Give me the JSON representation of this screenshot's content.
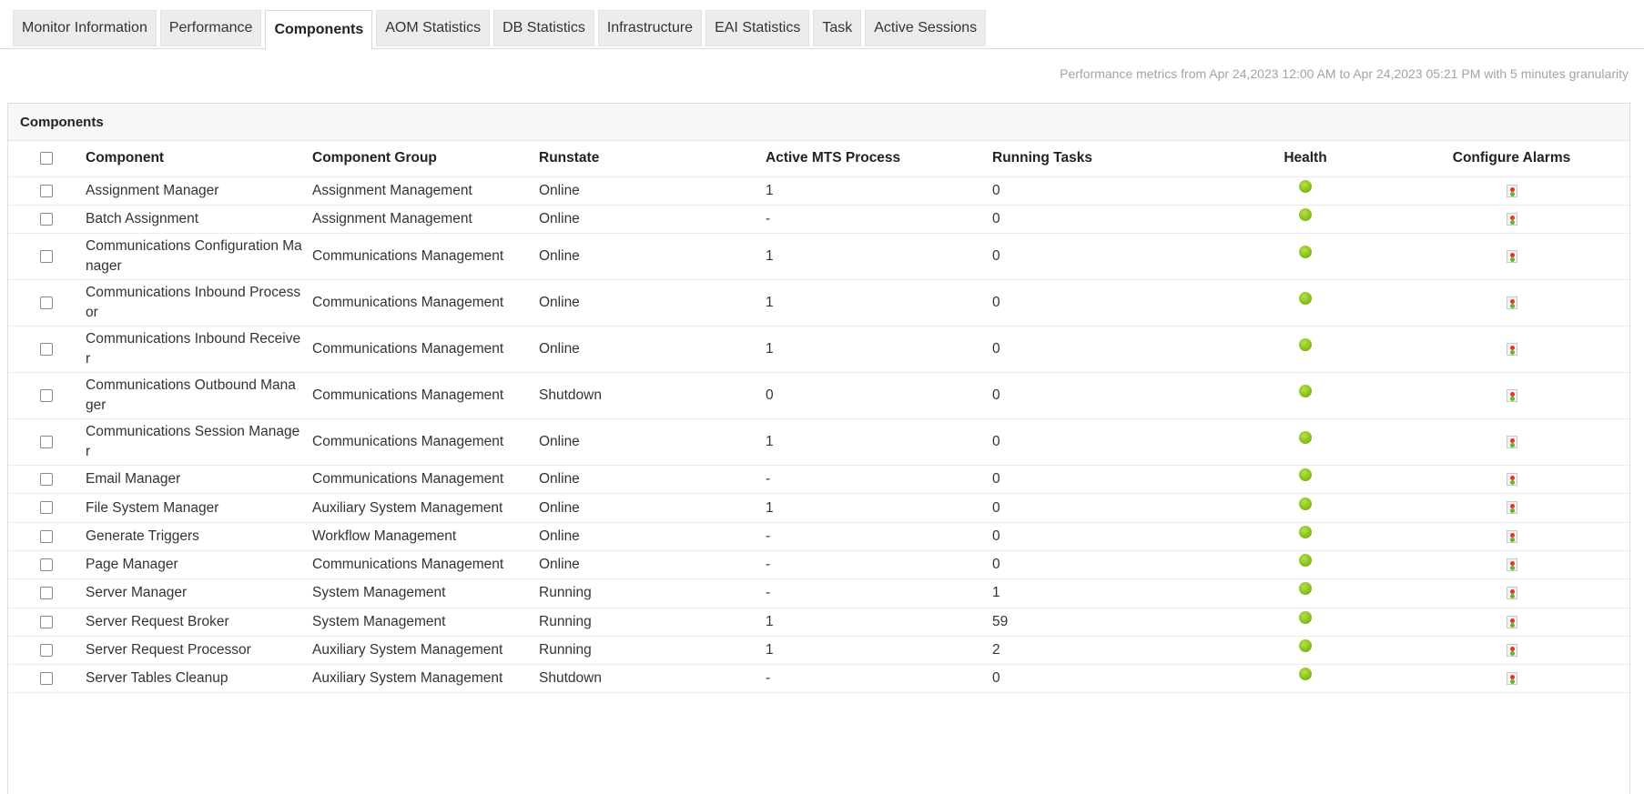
{
  "tabs": [
    {
      "label": "Monitor Information",
      "active": false
    },
    {
      "label": "Performance",
      "active": false
    },
    {
      "label": "Components",
      "active": true
    },
    {
      "label": "AOM Statistics",
      "active": false
    },
    {
      "label": "DB Statistics",
      "active": false
    },
    {
      "label": "Infrastructure",
      "active": false
    },
    {
      "label": "EAI Statistics",
      "active": false
    },
    {
      "label": "Task",
      "active": false
    },
    {
      "label": "Active Sessions",
      "active": false
    }
  ],
  "metrics_text": "Performance metrics from Apr 24,2023 12:00 AM to Apr 24,2023 05:21 PM with 5 minutes granularity",
  "panel": {
    "title": "Components",
    "columns": [
      "Component",
      "Component Group",
      "Runstate",
      "Active MTS Process",
      "Running Tasks",
      "Health",
      "Configure Alarms"
    ],
    "health_color": "#8cc11e",
    "rows": [
      {
        "component": "Assignment Manager",
        "group": "Assignment Management",
        "runstate": "Online",
        "mts": "1",
        "tasks": "0",
        "health": "ok"
      },
      {
        "component": "Batch Assignment",
        "group": "Assignment Management",
        "runstate": "Online",
        "mts": "-",
        "tasks": "0",
        "health": "ok"
      },
      {
        "component": "Communications Configuration Manager",
        "group": "Communications Management",
        "runstate": "Online",
        "mts": "1",
        "tasks": "0",
        "health": "ok"
      },
      {
        "component": "Communications Inbound Processor",
        "group": "Communications Management",
        "runstate": "Online",
        "mts": "1",
        "tasks": "0",
        "health": "ok"
      },
      {
        "component": "Communications Inbound Receiver",
        "group": "Communications Management",
        "runstate": "Online",
        "mts": "1",
        "tasks": "0",
        "health": "ok"
      },
      {
        "component": "Communications Outbound Manager",
        "group": "Communications Management",
        "runstate": "Shutdown",
        "mts": "0",
        "tasks": "0",
        "health": "ok"
      },
      {
        "component": "Communications Session Manager",
        "group": "Communications Management",
        "runstate": "Online",
        "mts": "1",
        "tasks": "0",
        "health": "ok"
      },
      {
        "component": "Email Manager",
        "group": "Communications Management",
        "runstate": "Online",
        "mts": "-",
        "tasks": "0",
        "health": "ok"
      },
      {
        "component": "File System Manager",
        "group": "Auxiliary System Management",
        "runstate": "Online",
        "mts": "1",
        "tasks": "0",
        "health": "ok"
      },
      {
        "component": "Generate Triggers",
        "group": "Workflow Management",
        "runstate": "Online",
        "mts": "-",
        "tasks": "0",
        "health": "ok"
      },
      {
        "component": "Page Manager",
        "group": "Communications Management",
        "runstate": "Online",
        "mts": "-",
        "tasks": "0",
        "health": "ok"
      },
      {
        "component": "Server Manager",
        "group": "System Management",
        "runstate": "Running",
        "mts": "-",
        "tasks": "1",
        "health": "ok"
      },
      {
        "component": "Server Request Broker",
        "group": "System Management",
        "runstate": "Running",
        "mts": "1",
        "tasks": "59",
        "health": "ok"
      },
      {
        "component": "Server Request Processor",
        "group": "Auxiliary System Management",
        "runstate": "Running",
        "mts": "1",
        "tasks": "2",
        "health": "ok"
      },
      {
        "component": "Server Tables Cleanup",
        "group": "Auxiliary System Management",
        "runstate": "Shutdown",
        "mts": "-",
        "tasks": "0",
        "health": "ok"
      }
    ]
  }
}
